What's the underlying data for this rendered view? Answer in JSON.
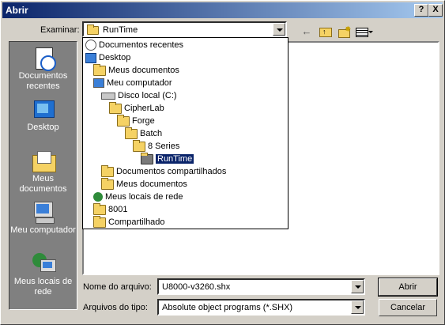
{
  "window": {
    "title": "Abrir",
    "help_btn": "?",
    "close_btn": "X"
  },
  "lookin": {
    "label": "Examinar:",
    "value": "RunTime"
  },
  "places": [
    {
      "label": "Documentos recentes"
    },
    {
      "label": "Desktop"
    },
    {
      "label": "Meus documentos"
    },
    {
      "label": "Meu computador"
    },
    {
      "label": "Meus locais de rede"
    }
  ],
  "dropdown_items": [
    {
      "label": "Documentos recentes",
      "icon": "recent-docs-icon"
    },
    {
      "label": "Desktop",
      "icon": "desktop-icon"
    },
    {
      "label": "Meus documentos",
      "icon": "my-documents-icon"
    },
    {
      "label": "Meu computador",
      "icon": "computer-icon"
    },
    {
      "label": "Disco local (C:)",
      "icon": "drive-icon"
    },
    {
      "label": "CipherLab",
      "icon": "folder-icon"
    },
    {
      "label": "Forge",
      "icon": "folder-icon"
    },
    {
      "label": "Batch",
      "icon": "folder-icon"
    },
    {
      "label": "8 Series",
      "icon": "folder-icon"
    },
    {
      "label": "RunTime",
      "icon": "folder-open-icon",
      "selected": true
    },
    {
      "label": "Documentos compartilhados",
      "icon": "folder-icon"
    },
    {
      "label": "Meus documentos",
      "icon": "folder-icon"
    },
    {
      "label": "Meus locais de rede",
      "icon": "network-icon"
    },
    {
      "label": "8001",
      "icon": "folder-icon"
    },
    {
      "label": "Compartilhado",
      "icon": "folder-icon"
    }
  ],
  "filename": {
    "label": "Nome do arquivo:",
    "value": "U8000-v3260.shx"
  },
  "filetype": {
    "label": "Arquivos do tipo:",
    "value": "Absolute object programs (*.SHX)"
  },
  "buttons": {
    "open": "Abrir",
    "cancel": "Cancelar"
  }
}
